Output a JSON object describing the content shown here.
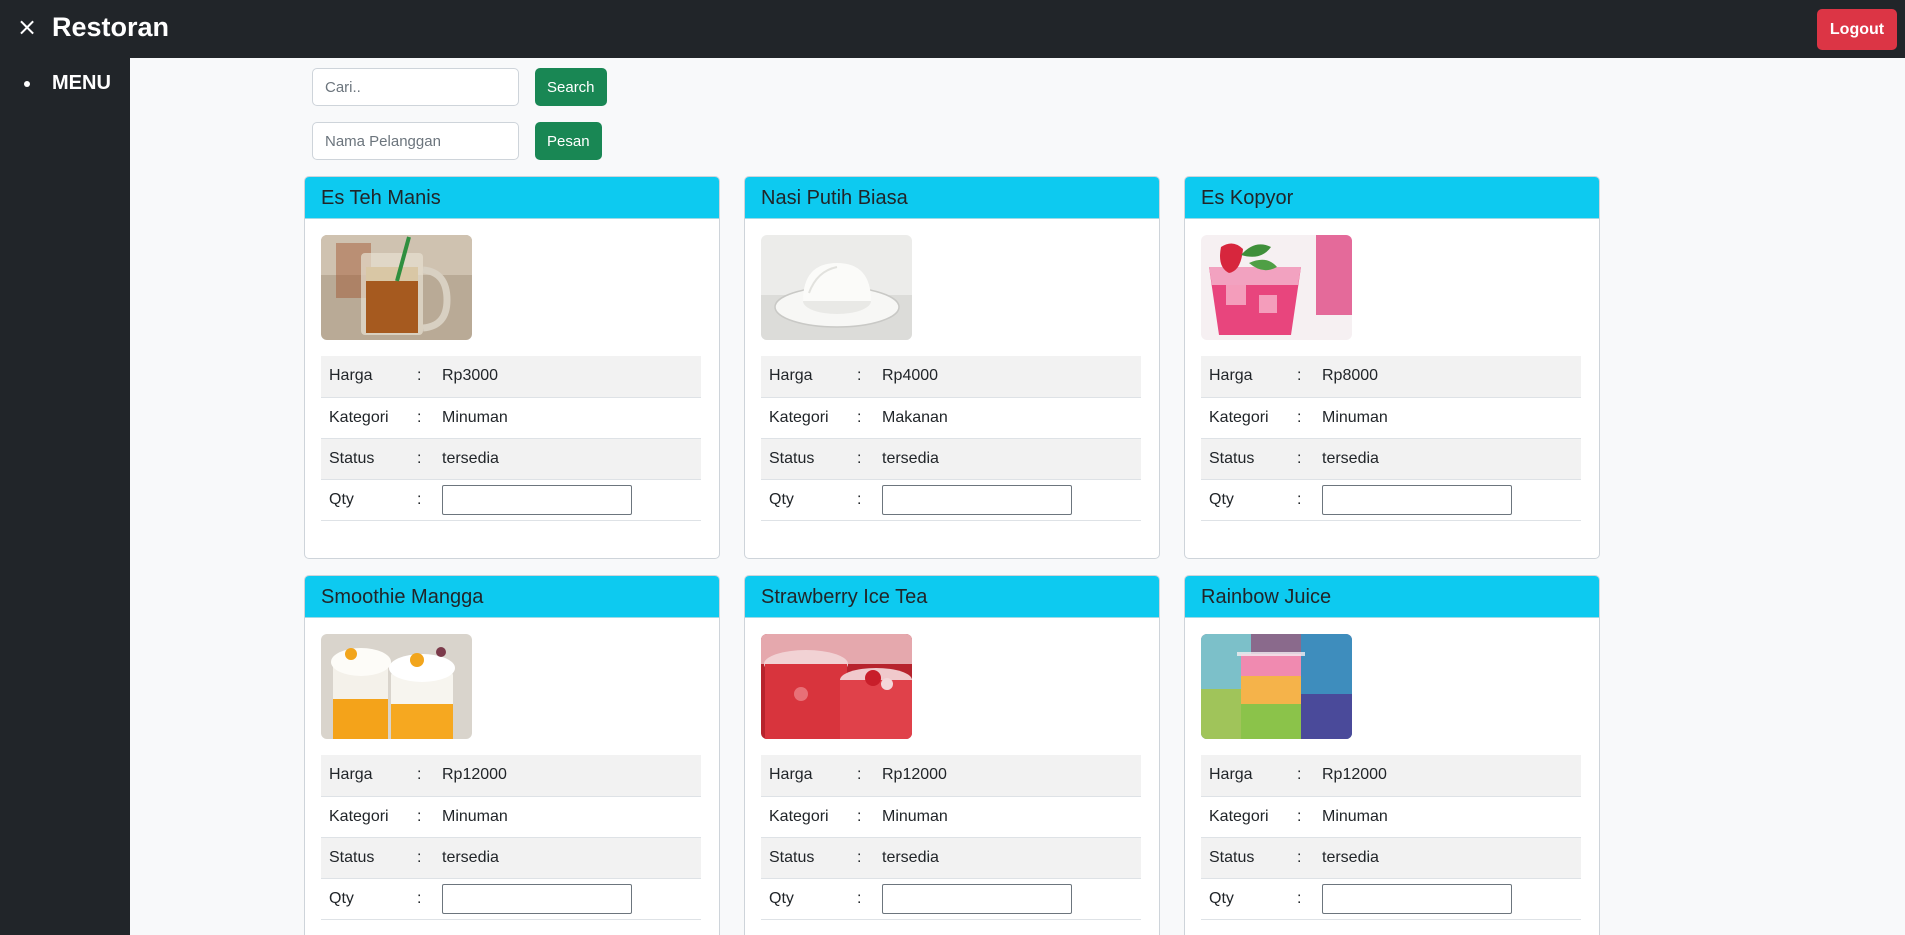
{
  "app": {
    "title": "Restoran",
    "close_icon": "×",
    "logout_label": "Logout"
  },
  "sidebar": {
    "items": [
      {
        "label": "MENU"
      }
    ]
  },
  "search": {
    "placeholder": "Cari..",
    "button_label": "Search"
  },
  "order": {
    "placeholder": "Nama Pelanggan",
    "button_label": "Pesan"
  },
  "field_labels": {
    "price": "Harga",
    "category": "Kategori",
    "status": "Status",
    "qty": "Qty",
    "separator": ":"
  },
  "menu_items": [
    {
      "name": "Es Teh Manis",
      "price": "Rp3000",
      "category": "Minuman",
      "status": "tersedia",
      "image": "iced-tea-glass"
    },
    {
      "name": "Nasi Putih Biasa",
      "price": "Rp4000",
      "category": "Makanan",
      "status": "tersedia",
      "image": "white-rice-plate"
    },
    {
      "name": "Es Kopyor",
      "price": "Rp8000",
      "category": "Minuman",
      "status": "tersedia",
      "image": "pink-iced-drink"
    },
    {
      "name": "Smoothie Mangga",
      "price": "Rp12000",
      "category": "Minuman",
      "status": "tersedia",
      "image": "mango-smoothie-jars"
    },
    {
      "name": "Strawberry Ice Tea",
      "price": "Rp12000",
      "category": "Minuman",
      "status": "tersedia",
      "image": "strawberry-ice-tea-jars"
    },
    {
      "name": "Rainbow Juice",
      "price": "Rp12000",
      "category": "Minuman",
      "status": "tersedia",
      "image": "rainbow-juice-glasses"
    }
  ],
  "colors": {
    "topbar": "#212529",
    "card_header": "#0dcaf0",
    "button_green": "#198754",
    "button_red": "#dc3545"
  }
}
